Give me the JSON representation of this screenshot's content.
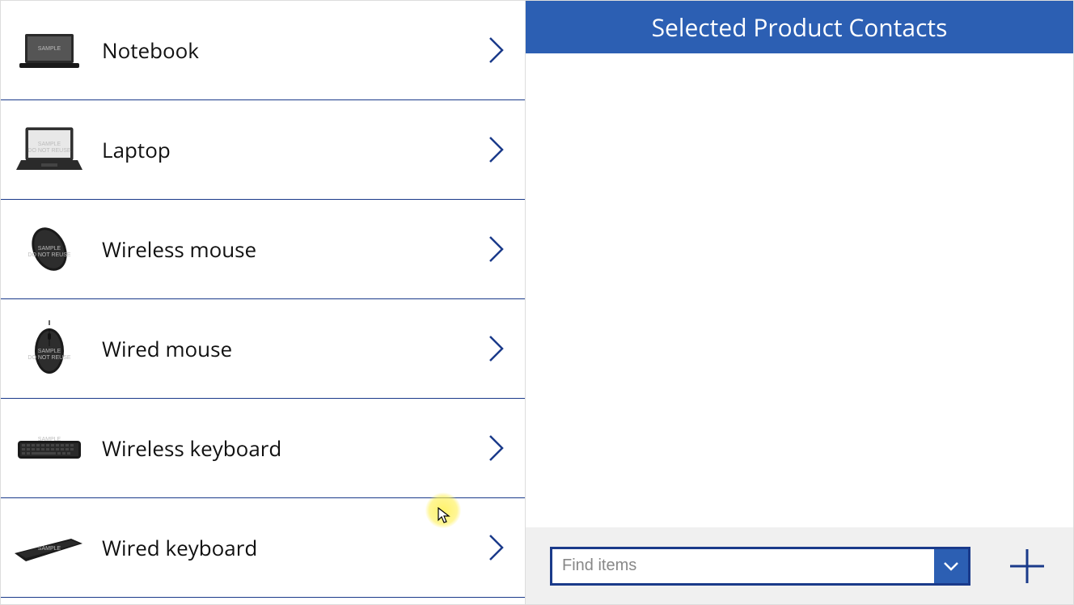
{
  "products": [
    {
      "label": "Notebook",
      "icon": "laptop-closed"
    },
    {
      "label": "Laptop",
      "icon": "laptop-open"
    },
    {
      "label": "Wireless mouse",
      "icon": "mouse-wireless"
    },
    {
      "label": "Wired mouse",
      "icon": "mouse-wired"
    },
    {
      "label": "Wireless keyboard",
      "icon": "keyboard"
    },
    {
      "label": "Wired keyboard",
      "icon": "keyboard-angled"
    }
  ],
  "right": {
    "header": "Selected Product Contacts",
    "find_placeholder": "Find items"
  }
}
